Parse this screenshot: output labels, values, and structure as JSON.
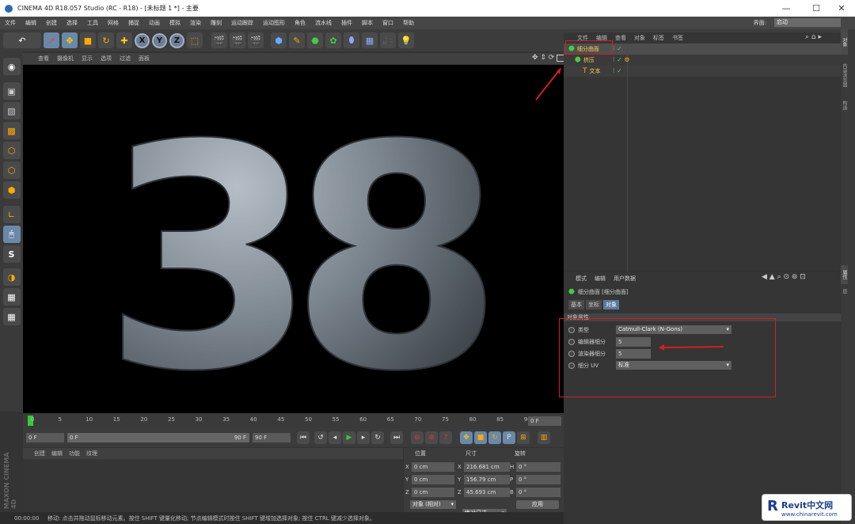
{
  "app": {
    "title": "CINEMA 4D R18.057 Studio (RC - R18) - [未标题 1 *] - 主要"
  },
  "window_controls": {
    "min": "—",
    "max": "☐",
    "close": "✕"
  },
  "menubar": {
    "items": [
      "文件",
      "编辑",
      "创建",
      "选择",
      "工具",
      "网格",
      "捕捉",
      "动画",
      "模拟",
      "渲染",
      "雕刻",
      "运动跟踪",
      "运动图形",
      "角色",
      "流水线",
      "插件",
      "脚本",
      "窗口",
      "帮助"
    ],
    "interface_label": "界面:",
    "interface_value": "启动"
  },
  "toolbar": {
    "undo": "↶",
    "axes": [
      "X",
      "Y",
      "Z"
    ]
  },
  "viewport": {
    "menu": [
      "查看",
      "摄像机",
      "显示",
      "选项",
      "过滤",
      "面板"
    ],
    "model_text": "38"
  },
  "timeline": {
    "ticks": [
      "0",
      "5",
      "10",
      "15",
      "20",
      "25",
      "30",
      "35",
      "40",
      "45",
      "50",
      "55",
      "60",
      "65",
      "70",
      "75",
      "80",
      "85",
      "90"
    ],
    "current_frame": "0 F"
  },
  "transport": {
    "start_field": "0 F",
    "slider_left": "0 F",
    "slider_right": "90 F",
    "end_field": "90 F"
  },
  "material_menu": [
    "创建",
    "编辑",
    "功能",
    "纹理"
  ],
  "maxon_logo": "MAXON CINEMA 4D",
  "coords": {
    "headers": [
      "位置",
      "尺寸",
      "旋转"
    ],
    "rows": [
      {
        "axis": "X",
        "pos": "0 cm",
        "size_axis": "X",
        "size": "216.681 cm",
        "rot_axis": "H",
        "rot": "0 °"
      },
      {
        "axis": "Y",
        "pos": "0 cm",
        "size_axis": "Y",
        "size": "156.79 cm",
        "rot_axis": "P",
        "rot": "0 °"
      },
      {
        "axis": "Z",
        "pos": "0 cm",
        "size_axis": "Z",
        "size": "45.693 cm",
        "rot_axis": "B",
        "rot": "0 °"
      }
    ],
    "mode1": "对象 (相对)",
    "mode2": "绝对尺寸",
    "apply": "应用"
  },
  "status": {
    "time": "00:00:00",
    "message": "移动: 点击并拖动鼠标移动元素。按住 SHIFT 键量化移动; 节点编辑模式时按住 SHIFT 键增加选择对象; 按住 CTRL 键减少选择对象。"
  },
  "object_manager": {
    "menu": [
      "文件",
      "编辑",
      "查看",
      "对象",
      "标签",
      "书签"
    ],
    "objects": [
      {
        "name": "细分曲面",
        "level": 0
      },
      {
        "name": "挤压",
        "level": 1
      },
      {
        "name": "文本",
        "level": 2
      }
    ]
  },
  "attributes": {
    "menu": [
      "模式",
      "编辑",
      "用户数据"
    ],
    "object_title": "细分曲面 [细分曲面]",
    "tabs": [
      "基本",
      "坐标",
      "对象"
    ],
    "section": "对象属性",
    "fields": [
      {
        "label": "类型",
        "value": "Catmull-Clark (N-Gons)",
        "kind": "dropdown"
      },
      {
        "label": "编辑器细分",
        "value": "5",
        "kind": "number"
      },
      {
        "label": "渲染器细分",
        "value": "5",
        "kind": "number"
      },
      {
        "label": "细分 UV",
        "value": "标准",
        "kind": "dropdown"
      }
    ]
  },
  "right_tabs": [
    "对象",
    "内容浏览器",
    "构造",
    "属性",
    "层"
  ],
  "watermark": {
    "brand": "Revit中文网",
    "url": "www.chinarevit.com"
  },
  "colors": {
    "accent_red": "#d02020",
    "viewport_bg": "#000000",
    "model": "#8a949c"
  }
}
